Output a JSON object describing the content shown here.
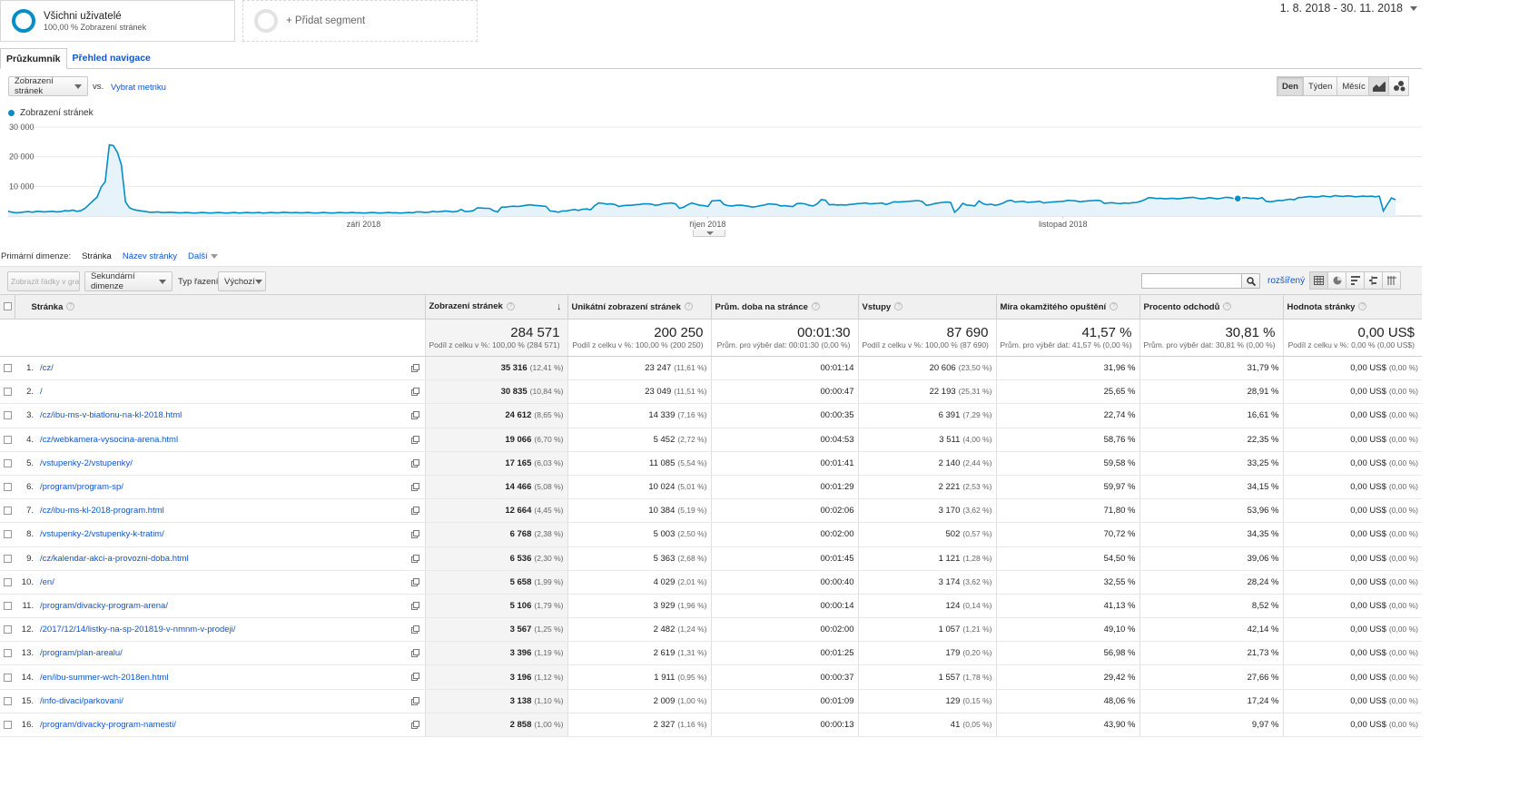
{
  "segments": {
    "all_users": {
      "name": "Všichni uživatelé",
      "sub": "100,00 % Zobrazení stránek"
    },
    "add_segment_label": "+ Přidat segment"
  },
  "date_range": "1. 8. 2018 - 30. 11. 2018",
  "tabs": [
    {
      "label": "Průzkumník",
      "active": true
    },
    {
      "label": "Přehled navigace",
      "active": false
    }
  ],
  "controls": {
    "metric_select": "Zobrazení stránek",
    "vs_label": "vs.",
    "select_metric_link": "Vybrat metriku",
    "period_buttons": [
      {
        "label": "Den",
        "active": true
      },
      {
        "label": "Týden",
        "active": false
      },
      {
        "label": "Měsíc",
        "active": false
      }
    ],
    "chart_type_icons": [
      "line-chart-icon",
      "motion-chart-icon"
    ]
  },
  "chart_legend": "Zobrazení stránek",
  "chart_data": {
    "type": "area",
    "series": [
      {
        "name": "Zobrazení stránek",
        "values": [
          1600,
          1300,
          1100,
          1200,
          1400,
          1500,
          1300,
          1600,
          1500,
          1400,
          1500,
          1600,
          1400,
          1500,
          1800,
          1700,
          2000,
          1600,
          1800,
          2600,
          3900,
          5200,
          6400,
          9800,
          11600,
          24000,
          23800,
          21500,
          17200,
          4800,
          2800,
          2200,
          1900,
          1700,
          1500,
          1300,
          1300,
          1400,
          1200,
          1200,
          1300,
          1200,
          1100,
          1100,
          1200,
          1100,
          1000,
          1100,
          1200,
          1100,
          1000,
          1100,
          1200,
          1100,
          1000,
          1100,
          1200,
          1000,
          1100,
          1200,
          1100,
          1100,
          1200,
          1000,
          1100,
          1200,
          1100,
          1100,
          1300,
          1200,
          1100,
          1200,
          1100,
          1100,
          1200,
          1100,
          1000,
          1100,
          1200,
          1100,
          1000,
          1100,
          1200,
          1100,
          1100,
          1200,
          1100,
          1100,
          1000,
          1100,
          1200,
          1100,
          1000,
          1100,
          1200,
          1100,
          1100,
          1000,
          1100,
          1200,
          1100,
          1400,
          1400,
          1200,
          1300,
          1600,
          1400,
          1500,
          1700,
          1600,
          1400,
          1600,
          2200,
          1500,
          1600,
          1800,
          2800,
          2700,
          2600,
          2600,
          1800,
          1400,
          3000,
          3000,
          3200,
          3300,
          3200,
          3400,
          3600,
          3800,
          3600,
          3500,
          3400,
          3200,
          1700,
          1600,
          1300,
          1700,
          1700,
          2000,
          2200,
          1900,
          2300,
          2400,
          2100,
          3500,
          4400,
          4300,
          4000,
          4100,
          3900,
          3200,
          3500,
          3600,
          3600,
          3800,
          3900,
          4100,
          4100,
          4000,
          3600,
          3800,
          4200,
          4300,
          4400,
          4100,
          2600,
          3000,
          3800,
          4400,
          4000,
          3600,
          3500,
          3200,
          5100,
          5200,
          5300,
          3900,
          3500,
          3400,
          3600,
          3700,
          3500,
          3300,
          3000,
          3200,
          3500,
          3700,
          4100,
          4000,
          3900,
          3400,
          3500,
          3300,
          3200,
          4200,
          4300,
          4100,
          3600,
          3400,
          4100,
          5500,
          5400,
          3800,
          3900,
          3700,
          3800,
          3700,
          3900,
          4000,
          4200,
          4300,
          4400,
          4100,
          4200,
          4300,
          4400,
          3900,
          4300,
          4800,
          4700,
          4800,
          4900,
          5000,
          5100,
          5200,
          4900,
          3600,
          3800,
          4200,
          4400,
          4600,
          4700,
          4600,
          1300,
          2500,
          4300,
          3700,
          3600,
          3400,
          5100,
          4200,
          3800,
          4000,
          3600,
          3900,
          4400,
          5100,
          5300,
          4700,
          4900,
          5000,
          4600,
          4700,
          4800,
          5000,
          4400,
          4600,
          4700,
          4800,
          4900,
          5000,
          5300,
          5200,
          5100,
          4800,
          5000,
          5100,
          5200,
          5300,
          5200,
          4300,
          4400,
          4500,
          4300,
          4200,
          4400,
          4300,
          4500,
          4600,
          5000,
          5500,
          6200,
          6100,
          5900,
          6000,
          5800,
          5900,
          6000,
          5800,
          5900,
          6100,
          6200,
          6300,
          6000,
          5800,
          5900,
          6200,
          6000,
          5800,
          6000,
          6300,
          6200,
          5900,
          5900,
          6100,
          6200,
          6000,
          6000,
          5800,
          6200,
          5000,
          4800,
          5000,
          5300,
          5200,
          5500,
          5700,
          5500,
          6200,
          6300,
          6500,
          6600,
          6400,
          6500,
          6800,
          6600,
          6500,
          6900,
          6700,
          6600,
          6800,
          6700,
          6500,
          6600,
          6700,
          6600,
          6700,
          6500,
          6700,
          1700,
          4000,
          6100,
          5500
        ]
      }
    ],
    "x_labels": [
      "září 2018",
      "říjen 2018",
      "listopad 2018"
    ],
    "y_ticks": [
      "30 000",
      "20 000",
      "10 000"
    ],
    "ylim": [
      0,
      30000
    ],
    "grid": true,
    "highlight_point_index": 0
  },
  "dimension_bar": {
    "label": "Primární dimenze:",
    "current": "Stránka",
    "alt": "Název stránky",
    "more": "Další"
  },
  "toolbar": {
    "show_rows_button": "Zobrazit řádky v grafu",
    "secondary_dimension": "Sekundární dimenze",
    "sort_type_label": "Typ řazení:",
    "sort_type_value": "Výchozí",
    "search_placeholder": "",
    "advanced_link": "rozšířený",
    "view_icons": [
      "table-view-icon",
      "pie-view-icon",
      "performance-view-icon",
      "comparison-view-icon",
      "pivot-view-icon"
    ]
  },
  "table": {
    "columns": [
      "Stránka",
      "Zobrazení stránek",
      "Unikátní zobrazení stránek",
      "Prům. doba na stránce",
      "Vstupy",
      "Míra okamžitého opuštění",
      "Procento odchodů",
      "Hodnota stránky"
    ],
    "totals": [
      {
        "value": "284 571",
        "sub": "Podíl z celku v %: 100,00 % (284 571)"
      },
      {
        "value": "200 250",
        "sub": "Podíl z celku v %: 100,00 % (200 250)"
      },
      {
        "value": "00:01:30",
        "sub": "Prům. pro výběr dat: 00:01:30 (0,00 %)"
      },
      {
        "value": "87 690",
        "sub": "Podíl z celku v %: 100,00 % (87 690)"
      },
      {
        "value": "41,57 %",
        "sub": "Prům. pro výběr dat: 41,57 % (0,00 %)"
      },
      {
        "value": "30,81 %",
        "sub": "Prům. pro výběr dat: 30,81 % (0,00 %)"
      },
      {
        "value": "0,00 US$",
        "sub": "Podíl z celku v %: 0,00 % (0,00 US$)"
      }
    ],
    "rows": [
      {
        "n": "1.",
        "page": "/cz/",
        "views": "35 316",
        "views_pct": "(12,41 %)",
        "unique": "23 247",
        "unique_pct": "(11,61 %)",
        "avg": "00:01:14",
        "entries": "20 606",
        "entries_pct": "(23,50 %)",
        "bounce": "31,96 %",
        "exit": "31,79 %",
        "value": "0,00 US$",
        "value_pct": "(0,00 %)"
      },
      {
        "n": "2.",
        "page": "/",
        "views": "30 835",
        "views_pct": "(10,84 %)",
        "unique": "23 049",
        "unique_pct": "(11,51 %)",
        "avg": "00:00:47",
        "entries": "22 193",
        "entries_pct": "(25,31 %)",
        "bounce": "25,65 %",
        "exit": "28,91 %",
        "value": "0,00 US$",
        "value_pct": "(0,00 %)"
      },
      {
        "n": "3.",
        "page": "/cz/ibu-ms-v-biatlonu-na-kl-2018.html",
        "views": "24 612",
        "views_pct": "(8,65 %)",
        "unique": "14 339",
        "unique_pct": "(7,16 %)",
        "avg": "00:00:35",
        "entries": "6 391",
        "entries_pct": "(7,29 %)",
        "bounce": "22,74 %",
        "exit": "16,61 %",
        "value": "0,00 US$",
        "value_pct": "(0,00 %)"
      },
      {
        "n": "4.",
        "page": "/cz/webkamera-vysocina-arena.html",
        "views": "19 066",
        "views_pct": "(6,70 %)",
        "unique": "5 452",
        "unique_pct": "(2,72 %)",
        "avg": "00:04:53",
        "entries": "3 511",
        "entries_pct": "(4,00 %)",
        "bounce": "58,76 %",
        "exit": "22,35 %",
        "value": "0,00 US$",
        "value_pct": "(0,00 %)"
      },
      {
        "n": "5.",
        "page": "/vstupenky-2/vstupenky/",
        "views": "17 165",
        "views_pct": "(6,03 %)",
        "unique": "11 085",
        "unique_pct": "(5,54 %)",
        "avg": "00:01:41",
        "entries": "2 140",
        "entries_pct": "(2,44 %)",
        "bounce": "59,58 %",
        "exit": "33,25 %",
        "value": "0,00 US$",
        "value_pct": "(0,00 %)"
      },
      {
        "n": "6.",
        "page": "/program/program-sp/",
        "views": "14 466",
        "views_pct": "(5,08 %)",
        "unique": "10 024",
        "unique_pct": "(5,01 %)",
        "avg": "00:01:29",
        "entries": "2 221",
        "entries_pct": "(2,53 %)",
        "bounce": "59,97 %",
        "exit": "34,15 %",
        "value": "0,00 US$",
        "value_pct": "(0,00 %)"
      },
      {
        "n": "7.",
        "page": "/cz/ibu-ms-kl-2018-program.html",
        "views": "12 664",
        "views_pct": "(4,45 %)",
        "unique": "10 384",
        "unique_pct": "(5,19 %)",
        "avg": "00:02:06",
        "entries": "3 170",
        "entries_pct": "(3,62 %)",
        "bounce": "71,80 %",
        "exit": "53,96 %",
        "value": "0,00 US$",
        "value_pct": "(0,00 %)"
      },
      {
        "n": "8.",
        "page": "/vstupenky-2/vstupenky-k-tratim/",
        "views": "6 768",
        "views_pct": "(2,38 %)",
        "unique": "5 003",
        "unique_pct": "(2,50 %)",
        "avg": "00:02:00",
        "entries": "502",
        "entries_pct": "(0,57 %)",
        "bounce": "70,72 %",
        "exit": "34,35 %",
        "value": "0,00 US$",
        "value_pct": "(0,00 %)"
      },
      {
        "n": "9.",
        "page": "/cz/kalendar-akci-a-provozni-doba.html",
        "views": "6 536",
        "views_pct": "(2,30 %)",
        "unique": "5 363",
        "unique_pct": "(2,68 %)",
        "avg": "00:01:45",
        "entries": "1 121",
        "entries_pct": "(1,28 %)",
        "bounce": "54,50 %",
        "exit": "39,06 %",
        "value": "0,00 US$",
        "value_pct": "(0,00 %)"
      },
      {
        "n": "10.",
        "page": "/en/",
        "views": "5 658",
        "views_pct": "(1,99 %)",
        "unique": "4 029",
        "unique_pct": "(2,01 %)",
        "avg": "00:00:40",
        "entries": "3 174",
        "entries_pct": "(3,62 %)",
        "bounce": "32,55 %",
        "exit": "28,24 %",
        "value": "0,00 US$",
        "value_pct": "(0,00 %)"
      },
      {
        "n": "11.",
        "page": "/program/divacky-program-arena/",
        "views": "5 106",
        "views_pct": "(1,79 %)",
        "unique": "3 929",
        "unique_pct": "(1,96 %)",
        "avg": "00:00:14",
        "entries": "124",
        "entries_pct": "(0,14 %)",
        "bounce": "41,13 %",
        "exit": "8,52 %",
        "value": "0,00 US$",
        "value_pct": "(0,00 %)"
      },
      {
        "n": "12.",
        "page": "/2017/12/14/listky-na-sp-201819-v-nmnm-v-prodeji/",
        "views": "3 567",
        "views_pct": "(1,25 %)",
        "unique": "2 482",
        "unique_pct": "(1,24 %)",
        "avg": "00:02:00",
        "entries": "1 057",
        "entries_pct": "(1,21 %)",
        "bounce": "49,10 %",
        "exit": "42,14 %",
        "value": "0,00 US$",
        "value_pct": "(0,00 %)"
      },
      {
        "n": "13.",
        "page": "/program/plan-arealu/",
        "views": "3 396",
        "views_pct": "(1,19 %)",
        "unique": "2 619",
        "unique_pct": "(1,31 %)",
        "avg": "00:01:25",
        "entries": "179",
        "entries_pct": "(0,20 %)",
        "bounce": "56,98 %",
        "exit": "21,73 %",
        "value": "0,00 US$",
        "value_pct": "(0,00 %)"
      },
      {
        "n": "14.",
        "page": "/en/ibu-summer-wch-2018en.html",
        "views": "3 196",
        "views_pct": "(1,12 %)",
        "unique": "1 911",
        "unique_pct": "(0,95 %)",
        "avg": "00:00:37",
        "entries": "1 557",
        "entries_pct": "(1,78 %)",
        "bounce": "29,42 %",
        "exit": "27,66 %",
        "value": "0,00 US$",
        "value_pct": "(0,00 %)"
      },
      {
        "n": "15.",
        "page": "/info-divaci/parkovani/",
        "views": "3 138",
        "views_pct": "(1,10 %)",
        "unique": "2 009",
        "unique_pct": "(1,00 %)",
        "avg": "00:01:09",
        "entries": "129",
        "entries_pct": "(0,15 %)",
        "bounce": "48,06 %",
        "exit": "17,24 %",
        "value": "0,00 US$",
        "value_pct": "(0,00 %)"
      },
      {
        "n": "16.",
        "page": "/program/divacky-program-namesti/",
        "views": "2 858",
        "views_pct": "(1,00 %)",
        "unique": "2 327",
        "unique_pct": "(1,16 %)",
        "avg": "00:00:13",
        "entries": "41",
        "entries_pct": "(0,05 %)",
        "bounce": "43,90 %",
        "exit": "9,97 %",
        "value": "0,00 US$",
        "value_pct": "(0,00 %)"
      }
    ]
  },
  "colors": {
    "series": "#058dc7",
    "series_fill": "#e6f3fa",
    "link": "#1155cc",
    "grid": "#e8e8e8"
  }
}
